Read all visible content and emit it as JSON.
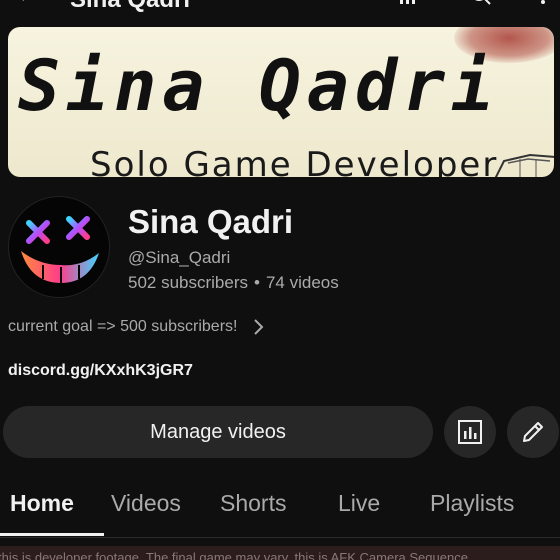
{
  "topbar": {
    "title": "Sina Qadri"
  },
  "banner": {
    "title": "Sina Qadri",
    "subtitle": "Solo Game Developer"
  },
  "channel": {
    "name": "Sina Qadri",
    "handle": "@Sina_Qadri",
    "subscribers": "502 subscribers",
    "separator": "•",
    "videos": "74 videos",
    "description": "current goal => 500 subscribers!",
    "link": "discord.gg/KXxhK3jGR7"
  },
  "actions": {
    "manage_label": "Manage videos"
  },
  "tabs": [
    {
      "label": "Home"
    },
    {
      "label": "Videos"
    },
    {
      "label": "Shorts"
    },
    {
      "label": "Live"
    },
    {
      "label": "Playlists"
    }
  ],
  "caption": "this is developer footage. The final game may vary. this is AFK Camera Sequence",
  "icons": [
    "back-arrow-icon",
    "cast-icon",
    "search-icon",
    "more-vert-icon",
    "chevron-right-icon",
    "analytics-icon",
    "pencil-icon"
  ],
  "colors": {
    "background": "#0f0f0f",
    "surface": "#272727",
    "text": "#f1f1f1",
    "secondary": "#aaaaaa"
  }
}
